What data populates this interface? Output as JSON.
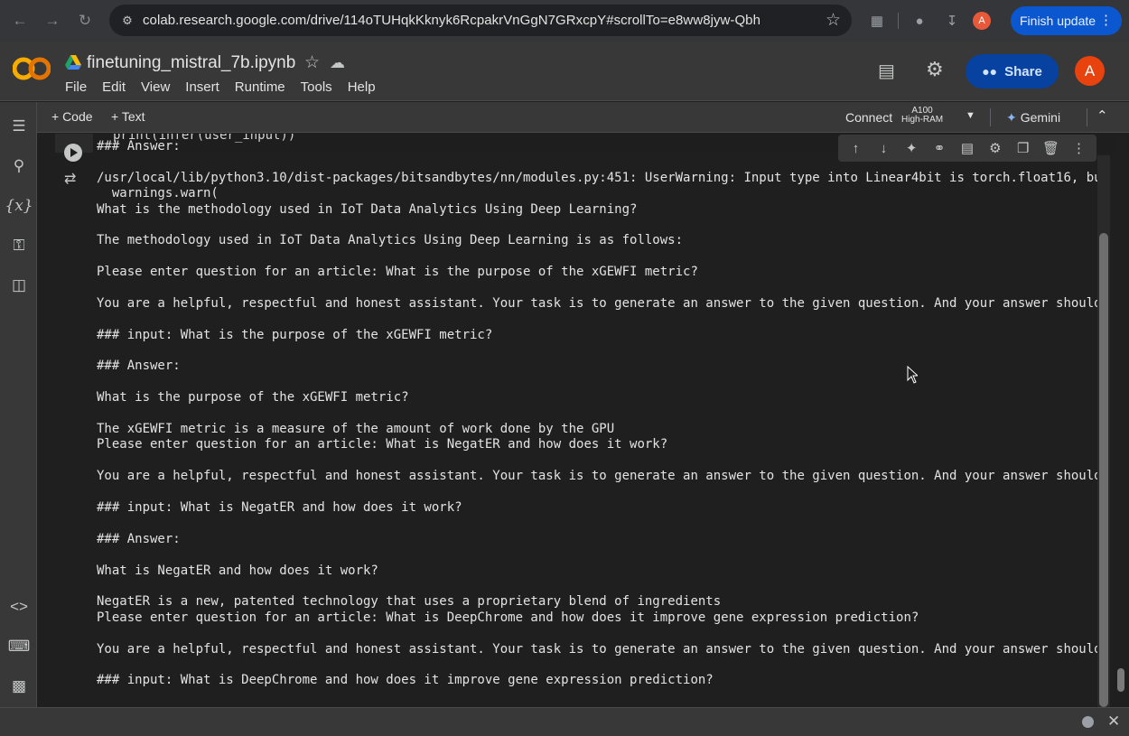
{
  "browser": {
    "url": "colab.research.google.com/drive/114oTUHqkKknyk6RcpakrVnGgN7GRxcpY#scrollTo=e8ww8jyw-Qbh",
    "profile_initial": "A",
    "finish_update_label": "Finish update"
  },
  "header": {
    "notebook_title": "finetuning_mistral_7b.ipynb",
    "menu": [
      "File",
      "Edit",
      "View",
      "Insert",
      "Runtime",
      "Tools",
      "Help"
    ],
    "share_label": "Share",
    "avatar_initial": "A"
  },
  "toolbar": {
    "add_code": "+ Code",
    "add_text": "+ Text",
    "connect": "Connect",
    "runtime_line1": "A100",
    "runtime_line2": "High-RAM",
    "gemini": "Gemini"
  },
  "cell": {
    "code_line": "print(infer(user_input))"
  },
  "output": {
    "lines": [
      "### Answer:",
      "",
      "/usr/local/lib/python3.10/dist-packages/bitsandbytes/nn/modules.py:451: UserWarning: Input type into Linear4bit is torch.float16, bu",
      "  warnings.warn(",
      "What is the methodology used in IoT Data Analytics Using Deep Learning?",
      "",
      "The methodology used in IoT Data Analytics Using Deep Learning is as follows:",
      "",
      "Please enter question for an article: What is the purpose of the xGEWFI metric?",
      "",
      "You are a helpful, respectful and honest assistant. Your task is to generate an answer to the given question. And your answer should",
      "",
      "### input: What is the purpose of the xGEWFI metric?",
      "",
      "### Answer:",
      "",
      "What is the purpose of the xGEWFI metric?",
      "",
      "The xGEWFI metric is a measure of the amount of work done by the GPU",
      "Please enter question for an article: What is NegatER and how does it work?",
      "",
      "You are a helpful, respectful and honest assistant. Your task is to generate an answer to the given question. And your answer should",
      "",
      "### input: What is NegatER and how does it work?",
      "",
      "### Answer:",
      "",
      "What is NegatER and how does it work?",
      "",
      "NegatER is a new, patented technology that uses a proprietary blend of ingredients",
      "Please enter question for an article: What is DeepChrome and how does it improve gene expression prediction?",
      "",
      "You are a helpful, respectful and honest assistant. Your task is to generate an answer to the given question. And your answer should",
      "",
      "### input: What is DeepChrome and how does it improve gene expression prediction?"
    ]
  },
  "icons": {
    "back": "back-arrow-icon",
    "forward": "forward-arrow-icon",
    "reload": "reload-icon",
    "colors": {
      "accent": "#0b57d0",
      "share_bg": "#0842a0",
      "avatar": "#e8430f",
      "colab_orange": "#f9ab00"
    }
  }
}
